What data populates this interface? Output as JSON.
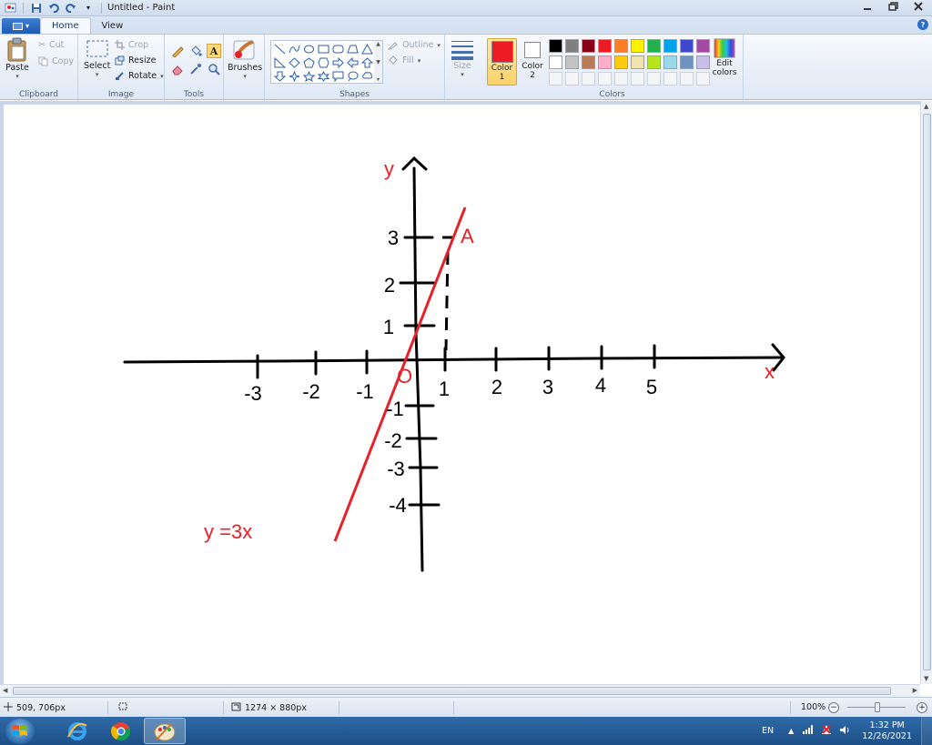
{
  "window": {
    "title": "Untitled - Paint"
  },
  "tabs": [
    {
      "label": "Home"
    },
    {
      "label": "View"
    }
  ],
  "ribbon": {
    "clipboard": {
      "group_label": "Clipboard",
      "paste": "Paste",
      "cut": "Cut",
      "copy": "Copy"
    },
    "image": {
      "group_label": "Image",
      "select": "Select",
      "crop": "Crop",
      "resize": "Resize",
      "rotate": "Rotate"
    },
    "tools": {
      "group_label": "Tools"
    },
    "brushes": {
      "label": "Brushes"
    },
    "shapes": {
      "group_label": "Shapes",
      "outline": "Outline",
      "fill": "Fill"
    },
    "size": {
      "label": "Size"
    },
    "colors": {
      "group_label": "Colors",
      "color1_label": "Color\n1",
      "color2_label": "Color\n2",
      "color1_value": "#ed1c24",
      "color2_value": "#ffffff",
      "edit_colors": "Edit colors",
      "palette_row1": [
        "#000000",
        "#7f7f7f",
        "#880015",
        "#ed1c24",
        "#ff7f27",
        "#fff200",
        "#22b14c",
        "#00a2e8",
        "#3f48cc",
        "#a349a4"
      ],
      "palette_row2": [
        "#ffffff",
        "#c3c3c3",
        "#b97a57",
        "#ffaec9",
        "#ffc90e",
        "#efe4b0",
        "#b5e61d",
        "#99d9ea",
        "#7092be",
        "#c8bfe7"
      ]
    }
  },
  "drawing": {
    "x_ticks": [
      "-3",
      "-2",
      "-1",
      "1",
      "2",
      "3",
      "4",
      "5"
    ],
    "y_ticks_pos": [
      "3",
      "2",
      "1"
    ],
    "y_ticks_neg": [
      "-1",
      "-2",
      "-3",
      "-4"
    ],
    "x_axis_label": "x",
    "y_axis_label": "y",
    "origin_label": "O",
    "point_label": "A",
    "equation": "y =3x",
    "ink_color": "#000000",
    "red_color": "#e8202a"
  },
  "statusbar": {
    "cursor_pos": "509, 706px",
    "canvas_size": "1274 × 880px",
    "zoom": "100%"
  },
  "taskbar": {
    "language": "EN",
    "time": "1:32 PM",
    "date": "12/26/2021"
  }
}
